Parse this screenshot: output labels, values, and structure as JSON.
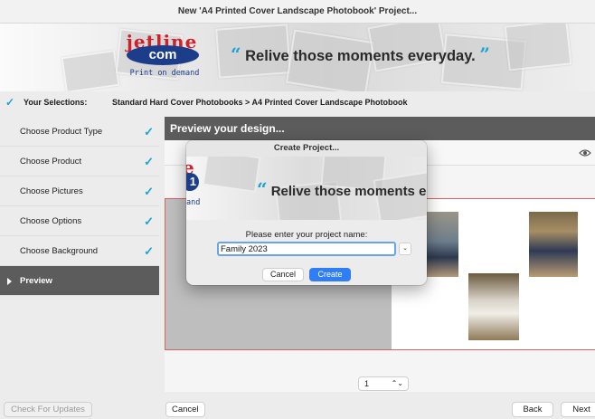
{
  "window": {
    "title": "New 'A4 Printed Cover Landscape Photobook' Project..."
  },
  "banner": {
    "logo_top": "jetline",
    "logo_mid": "com",
    "logo_bottom": "Print on demand",
    "tagline": "Relive those moments everyday.",
    "quote_open": "“",
    "quote_close": "”"
  },
  "selections": {
    "check": "✓",
    "label": "Your Selections:",
    "path": "Standard Hard Cover Photobooks > A4 Printed Cover Landscape Photobook"
  },
  "sidebar": {
    "items": [
      {
        "label": "Choose Product Type",
        "tick": "✓"
      },
      {
        "label": "Choose Product",
        "tick": "✓"
      },
      {
        "label": "Choose Pictures",
        "tick": "✓"
      },
      {
        "label": "Choose Options",
        "tick": "✓"
      },
      {
        "label": "Choose Background",
        "tick": "✓"
      },
      {
        "label": "Preview",
        "tick": ""
      }
    ]
  },
  "main": {
    "header": "Preview your design...",
    "page_selector": {
      "value": "1",
      "arrows": "⌃⌄"
    },
    "eye_icon": "eye-icon"
  },
  "footer": {
    "check_updates": "Check For Updates",
    "cancel": "Cancel",
    "back": "Back",
    "next": "Next"
  },
  "dialog": {
    "title": "Create Project...",
    "banner_tagline": "Relive those moments e",
    "banner_logo_and": "and",
    "prompt": "Please enter your project name:",
    "input_value": "Family 2023",
    "combo_glyph": "⌄",
    "cancel": "Cancel",
    "create": "Create"
  },
  "colors": {
    "accent": "#1aa3d6",
    "primary_button": "#2f7ef6",
    "active_step": "#5c5c5c",
    "logo_red": "#d0202a",
    "logo_blue": "#1c3d8a"
  }
}
